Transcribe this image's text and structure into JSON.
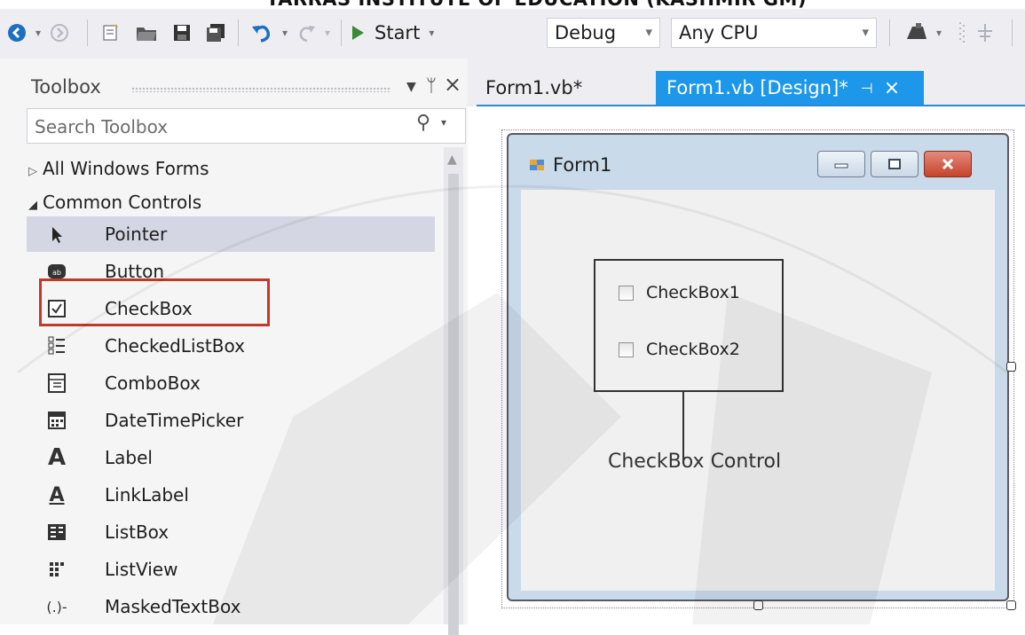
{
  "banner": {
    "text": "TARRAS INSTITUTE OF EDUCATION (KASHMIR GM)"
  },
  "toolbar": {
    "start_label": "Start",
    "config_value": "Debug",
    "platform_value": "Any CPU",
    "icons": [
      "back-icon",
      "forward-icon",
      "new-project-icon",
      "open-file-icon",
      "save-icon",
      "save-all-icon",
      "undo-icon",
      "redo-icon",
      "start-icon",
      "find-icon",
      "pin-toolbar-icon"
    ]
  },
  "toolbox": {
    "title": "Toolbox",
    "search_placeholder": "Search Toolbox",
    "groups": [
      {
        "label": "All Windows Forms",
        "expanded": false
      },
      {
        "label": "Common Controls",
        "expanded": true
      }
    ],
    "items": [
      {
        "label": "Pointer",
        "icon": "pointer-icon",
        "selected": true
      },
      {
        "label": "Button",
        "icon": "button-icon"
      },
      {
        "label": "CheckBox",
        "icon": "checkbox-icon",
        "highlighted": true
      },
      {
        "label": "CheckedListBox",
        "icon": "checkedlistbox-icon"
      },
      {
        "label": "ComboBox",
        "icon": "combobox-icon"
      },
      {
        "label": "DateTimePicker",
        "icon": "datetimepicker-icon"
      },
      {
        "label": "Label",
        "icon": "label-icon"
      },
      {
        "label": "LinkLabel",
        "icon": "linklabel-icon"
      },
      {
        "label": "ListBox",
        "icon": "listbox-icon"
      },
      {
        "label": "ListView",
        "icon": "listview-icon"
      },
      {
        "label": "MaskedTextBox",
        "icon": "maskedtextbox-icon"
      }
    ],
    "highlight_color": "#c0392b"
  },
  "editor": {
    "tabs": [
      {
        "label": "Form1.vb*",
        "active": false
      },
      {
        "label": "Form1.vb [Design]*",
        "active": true
      }
    ],
    "accent": "#1c97ea"
  },
  "form": {
    "title": "Form1",
    "checkboxes": [
      "CheckBox1",
      "CheckBox2"
    ],
    "callout": "CheckBox Control"
  }
}
